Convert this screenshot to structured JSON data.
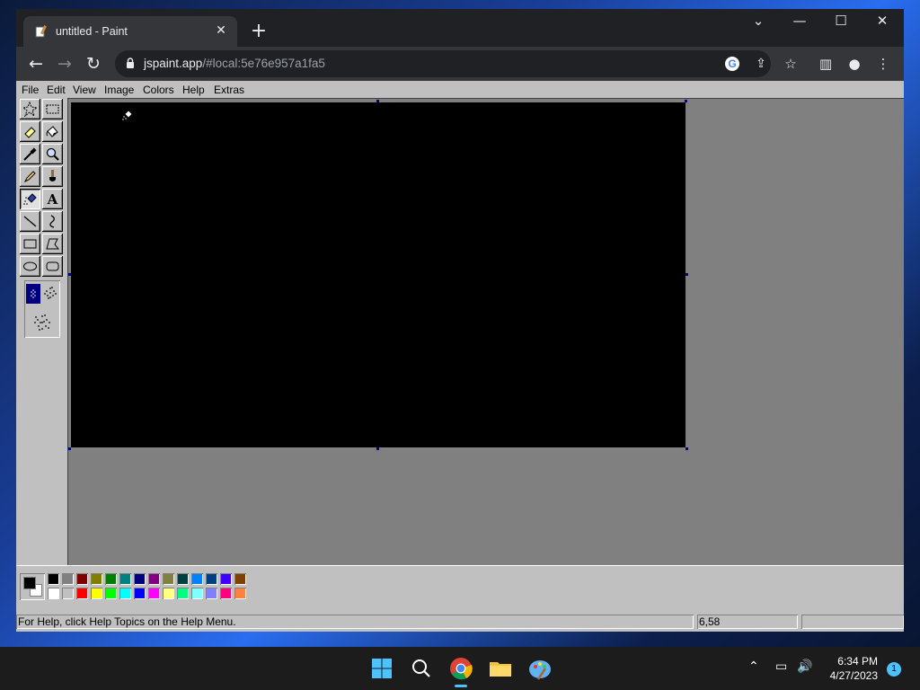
{
  "browser": {
    "tab_title": "untitled - Paint",
    "tab_close": "✕",
    "new_tab": "+",
    "url_host": "jspaint.app",
    "url_path": "/#local:5e76e957a1fa5",
    "window_controls": {
      "tabsearch": "⌄",
      "minimize": "—",
      "maximize": "☐",
      "close": "✕"
    }
  },
  "menu": {
    "file": "File",
    "edit": "Edit",
    "view": "View",
    "image": "Image",
    "colors": "Colors",
    "help": "Help",
    "extras": "Extras"
  },
  "tools": [
    "free-form-select",
    "select",
    "eraser",
    "fill-with-color",
    "pick-color",
    "magnifier",
    "pencil",
    "brush",
    "airbrush",
    "text",
    "line",
    "curve",
    "rectangle",
    "polygon",
    "ellipse",
    "rounded-rectangle"
  ],
  "selected_tool": "airbrush",
  "palette": {
    "foreground": "#000000",
    "background": "#ffffff",
    "top_row": [
      "#000000",
      "#808080",
      "#800000",
      "#808000",
      "#008000",
      "#008080",
      "#000080",
      "#800080",
      "#808040",
      "#004040",
      "#0080ff",
      "#004080",
      "#4000ff",
      "#804000"
    ],
    "bottom_row": [
      "#ffffff",
      "#c0c0c0",
      "#ff0000",
      "#ffff00",
      "#00ff00",
      "#00ffff",
      "#0000ff",
      "#ff00ff",
      "#ffff80",
      "#00ff80",
      "#80ffff",
      "#8080ff",
      "#ff0080",
      "#ff8040"
    ]
  },
  "status": {
    "help_text": "For Help, click Help Topics on the Help Menu.",
    "coordinates": "6,58",
    "size": ""
  },
  "taskbar": {
    "time": "6:34 PM",
    "date": "4/27/2023",
    "notification_count": "1",
    "apps": [
      "start",
      "search",
      "chrome",
      "file-explorer",
      "paint"
    ]
  }
}
